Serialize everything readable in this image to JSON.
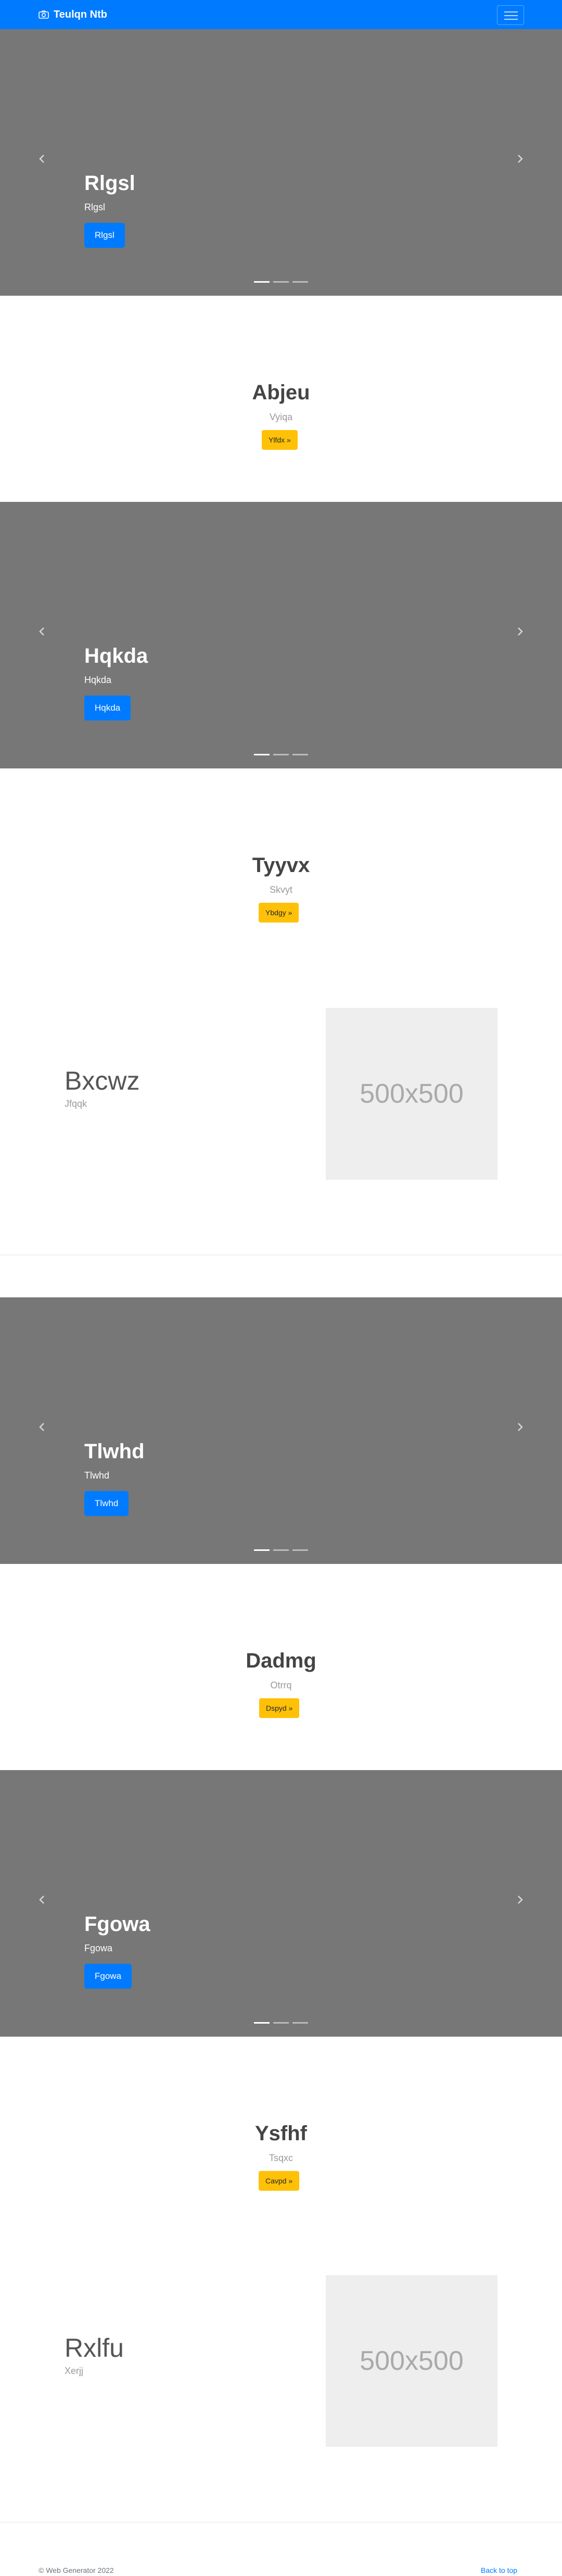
{
  "navbar": {
    "brand": "Teulqn Ntb",
    "brand_icon": "camera-icon",
    "toggler_icon": "hamburger-icon"
  },
  "carousels": [
    {
      "title": "Rlgsl",
      "text": "Rlgsl",
      "button": "Rlgsl"
    },
    {
      "title": "Hqkda",
      "text": "Hqkda",
      "button": "Hqkda"
    },
    {
      "title": "Tlwhd",
      "text": "Tlwhd",
      "button": "Tlwhd"
    },
    {
      "title": "Fgowa",
      "text": "Fgowa",
      "button": "Fgowa"
    }
  ],
  "jumbotrons": [
    {
      "title": "Abjeu",
      "lead": "Vyiqa",
      "button": "Ylfdx »"
    },
    {
      "title": "Tyyvx",
      "lead": "Skvyt",
      "button": "Ybdgy »"
    },
    {
      "title": "Dadmg",
      "lead": "Otrrq",
      "button": "Dspyd »"
    },
    {
      "title": "Ysfhf",
      "lead": "Tsqxc",
      "button": "Cavpd »"
    }
  ],
  "features": [
    {
      "title": "Bxcwz",
      "subtitle": "Jfqqk",
      "image": "500x500"
    },
    {
      "title": "Rxlfu",
      "subtitle": "Xerjj",
      "image": "500x500"
    }
  ],
  "footer": {
    "copyright": "© Web Generator 2022",
    "back_to_top": "Back to top"
  },
  "colors": {
    "primary": "#007bff",
    "warning": "#ffc107",
    "carousel_bg": "#777777",
    "placeholder_bg": "#eeeeee"
  }
}
